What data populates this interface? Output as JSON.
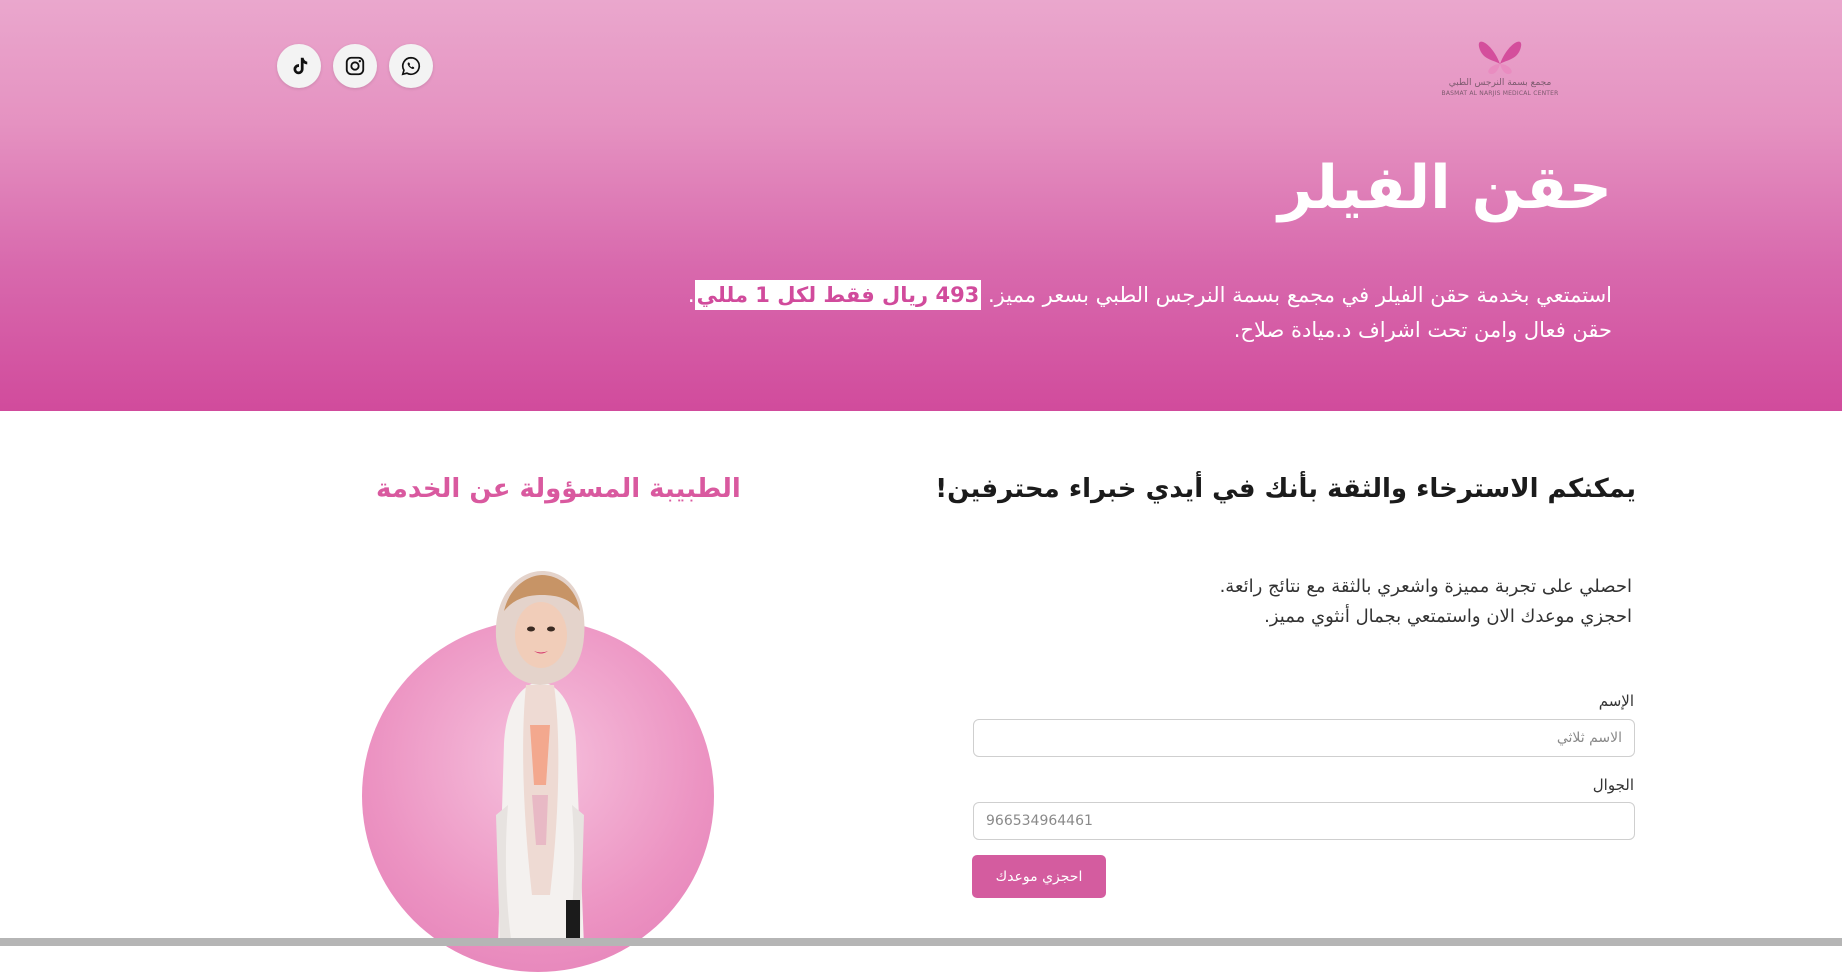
{
  "logo": {
    "name_ar": "مجمع بسمة النرجس الطبي",
    "name_en": "BASMAT AL NARJIS MEDICAL CENTER"
  },
  "social": [
    {
      "name": "whatsapp",
      "icon": "whatsapp-icon"
    },
    {
      "name": "instagram",
      "icon": "instagram-icon"
    },
    {
      "name": "tiktok",
      "icon": "tiktok-icon"
    }
  ],
  "hero": {
    "title": "حقن الفيلر",
    "desc_line1_prefix": "استمتعي بخدمة حقن الفيلر في مجمع بسمة النرجس الطبي بسعر مميز. ",
    "desc_highlight": "493 ريال فقط لكل 1 مللي",
    "desc_line1_suffix": ".",
    "desc_line2": "حقن فعال وامن تحت اشراف د.ميادة صلاح."
  },
  "section": {
    "heading": "يمكنكم الاسترخاء والثقة بأنك في أيدي خبراء محترفين!",
    "body_line1": "احصلي على تجربة مميزة واشعري بالثقة مع نتائج رائعة.",
    "body_line2": "احجزي موعدك الان واستمتعي بجمال أنثوي مميز."
  },
  "doctor": {
    "heading": "الطبيبة المسؤولة عن الخدمة"
  },
  "form": {
    "name_label": "الإسم",
    "name_placeholder": "الاسم ثلاثي",
    "phone_label": "الجوال",
    "phone_placeholder": "966534964461",
    "submit_label": "احجزي موعدك"
  },
  "colors": {
    "brand": "#d45c9f",
    "hero_top": "#eaa7cd",
    "hero_bottom": "#d14b9c"
  }
}
